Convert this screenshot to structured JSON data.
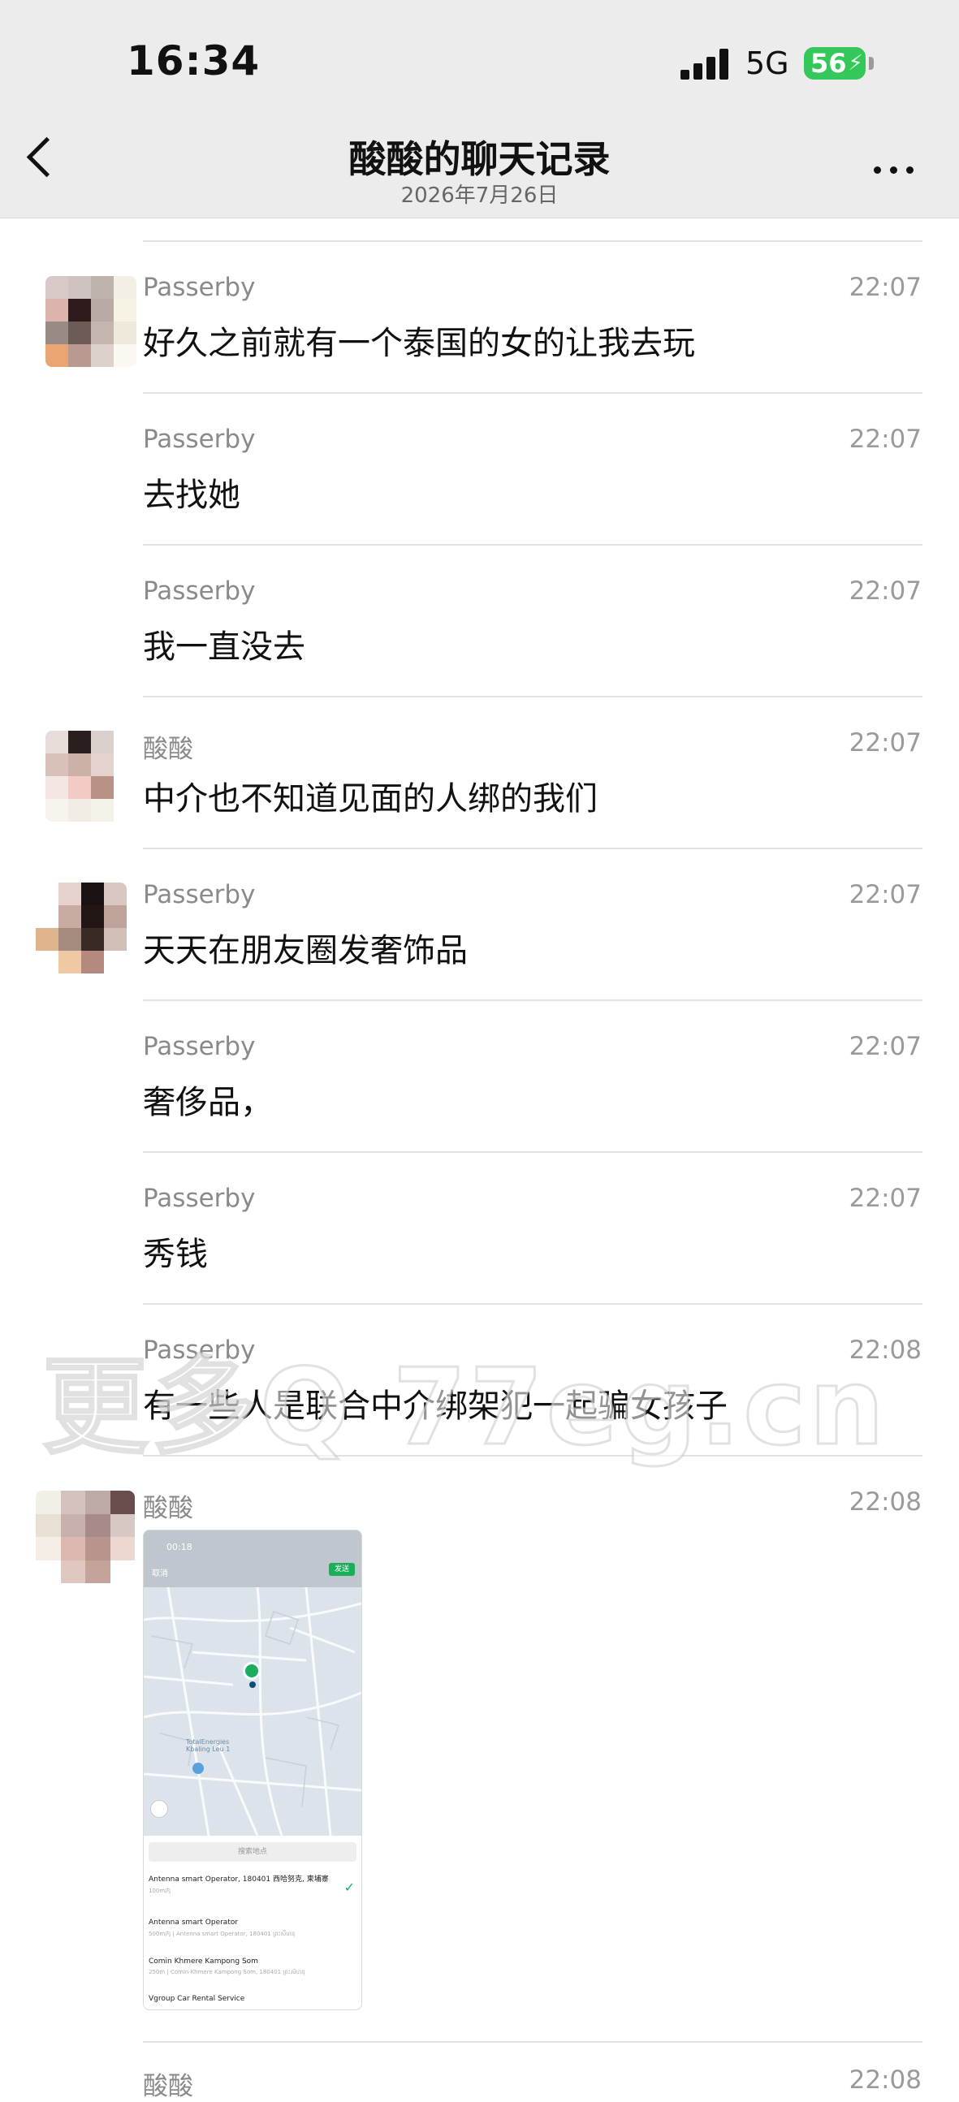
{
  "status_bar": {
    "time": "16:34",
    "network": "5G",
    "battery": "56"
  },
  "header": {
    "title": "酸酸的聊天记录",
    "subtitle": "2026年7月26日"
  },
  "messages": [
    {
      "sender": "Passerby",
      "time": "22:07",
      "text": "好久之前就有一个泰国的女的让我去玩"
    },
    {
      "sender": "Passerby",
      "time": "22:07",
      "text": "去找她"
    },
    {
      "sender": "Passerby",
      "time": "22:07",
      "text": "我一直没去"
    },
    {
      "sender": "酸酸",
      "time": "22:07",
      "text": "中介也不知道见面的人绑的我们"
    },
    {
      "sender": "Passerby",
      "time": "22:07",
      "text": "天天在朋友圈发奢饰品"
    },
    {
      "sender": "Passerby",
      "time": "22:07",
      "text": "奢侈品，"
    },
    {
      "sender": "Passerby",
      "time": "22:07",
      "text": "秀钱"
    },
    {
      "sender": "Passerby",
      "time": "22:08",
      "text": "有一些人是联合中介绑架犯一起骗女孩子"
    },
    {
      "sender": "酸酸",
      "time": "22:08",
      "text": ""
    },
    {
      "sender": "酸酸",
      "time": "22:08",
      "text": ""
    }
  ],
  "shared_image": {
    "status_time": "00:18",
    "cancel": "取消",
    "send": "发送",
    "map_label": "TotalEnergies Kbaling Leu 1",
    "search_placeholder": "搜索地点",
    "results": [
      {
        "title": "Antenna smart Operator, 180401 西哈努克, 柬埔寨",
        "sub": "100m内"
      },
      {
        "title": "Antenna smart Operator",
        "sub": "500m内 | Antenna smart Operator, 180401 ព្រះសីហនុ"
      },
      {
        "title": "Comin Khmere Kampong Som",
        "sub": "250m | Comin Khmere Kampong Som, 180401 ព្រះសីហនុ"
      },
      {
        "title": "Vgroup Car Rental Service",
        "sub": ""
      }
    ]
  },
  "watermark": "更多Q 77eg.cn"
}
